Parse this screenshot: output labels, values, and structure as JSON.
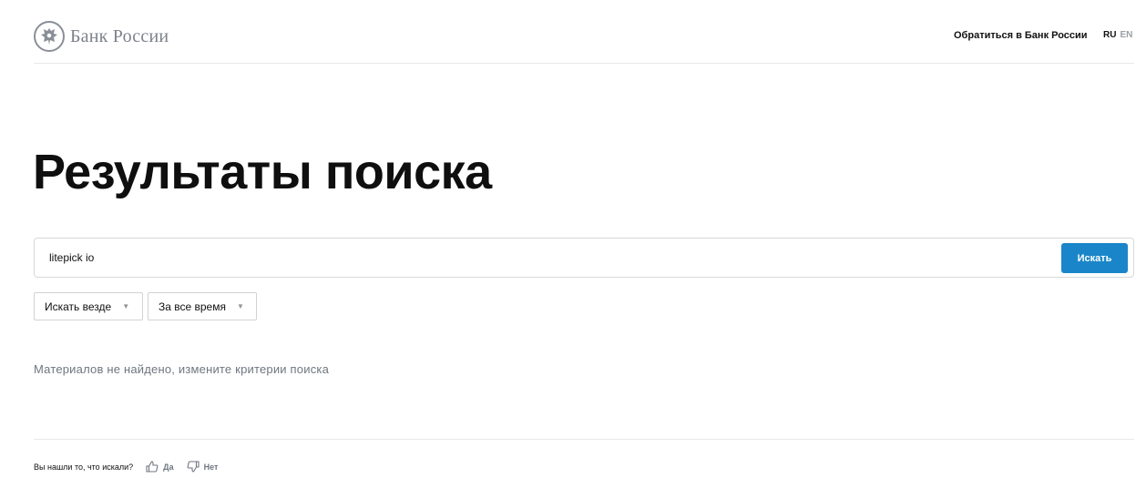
{
  "header": {
    "logo_text": "Банк России",
    "contact_link": "Обратиться в Банк России",
    "lang_active": "RU",
    "lang_inactive": "EN"
  },
  "main": {
    "title": "Результаты поиска",
    "search": {
      "value": "litepick io",
      "button_label": "Искать"
    },
    "filters": {
      "location": "Искать везде",
      "period": "За все время"
    },
    "no_results_text": "Материалов не найдено, измените критерии поиска"
  },
  "feedback": {
    "question": "Вы нашли то, что искали?",
    "yes_label": "Да",
    "no_label": "Нет"
  },
  "icons": {
    "emblem": "bank-emblem-icon",
    "dropdown": "triangle-down-icon",
    "like": "thumbs-up-icon",
    "dislike": "thumbs-down-icon"
  },
  "colors": {
    "accent": "#1a86c9",
    "muted_text": "#6f7680"
  }
}
